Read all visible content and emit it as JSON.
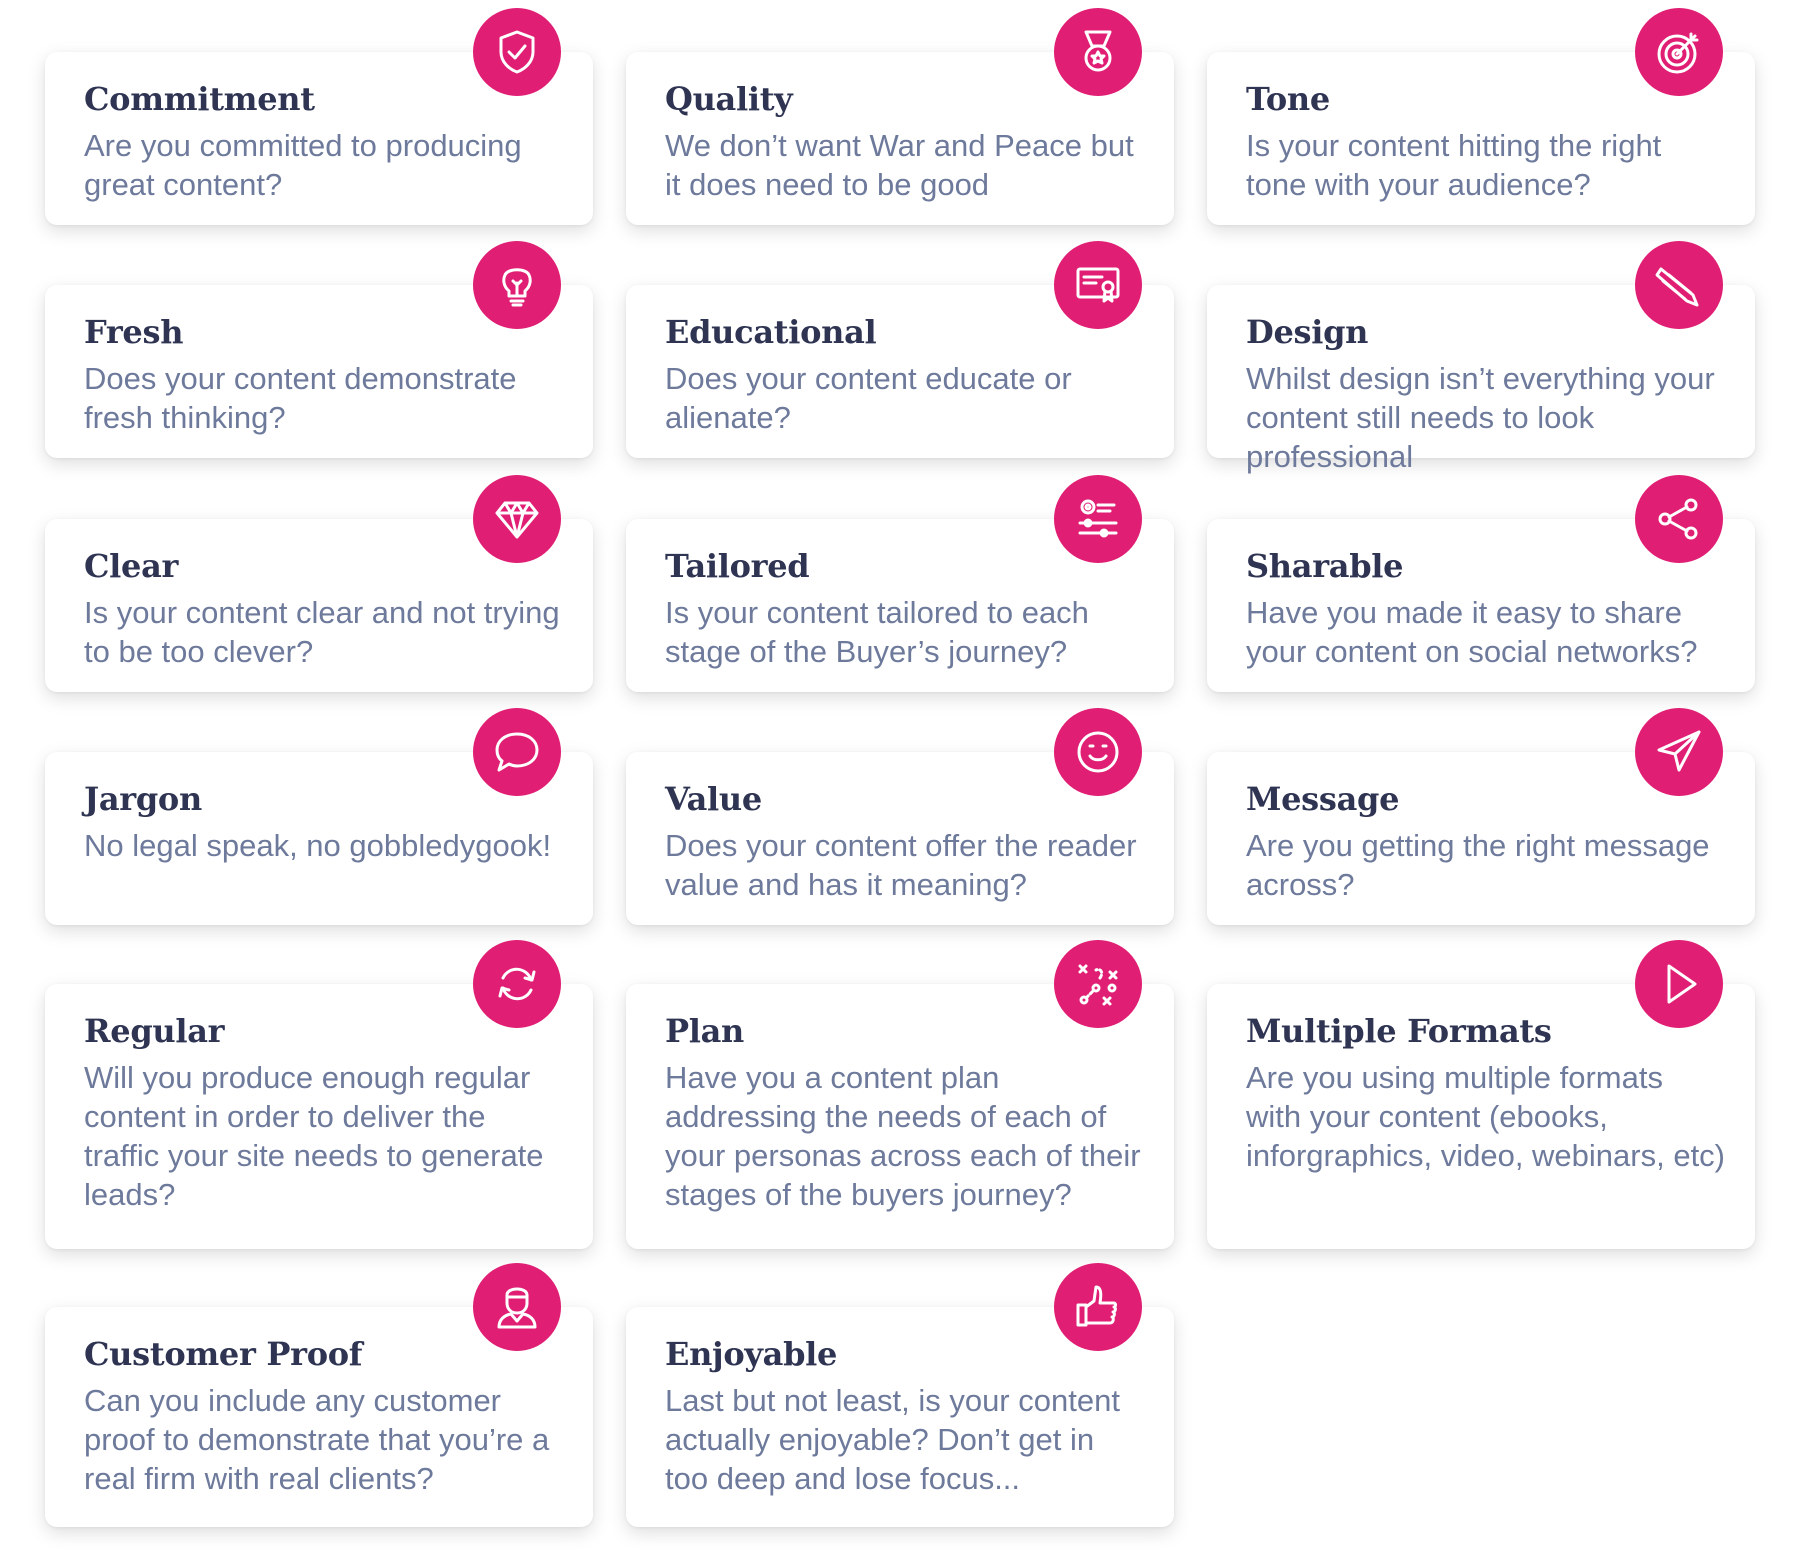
{
  "accent_color": "#e01e73",
  "title_color": "#2e3452",
  "text_color": "#6e7a9b",
  "cards": [
    {
      "title": "Commitment",
      "desc": "Are you committed to producing great content?",
      "icon": "shield-check-icon"
    },
    {
      "title": "Quality",
      "desc": "We don’t want War and Peace but it does need to be good",
      "icon": "medal-icon"
    },
    {
      "title": "Tone",
      "desc": "Is your content hitting the right tone with your audience?",
      "icon": "target-icon"
    },
    {
      "title": "Fresh",
      "desc": "Does your content demonstrate fresh thinking?",
      "icon": "lightbulb-icon"
    },
    {
      "title": "Educational",
      "desc": "Does your content educate or alienate?",
      "icon": "certificate-icon"
    },
    {
      "title": "Design",
      "desc": "Whilst design isn’t everything your content still needs to look professional",
      "icon": "pencil-icon"
    },
    {
      "title": "Clear",
      "desc": "Is your content clear and not trying to be too clever?",
      "icon": "diamond-icon"
    },
    {
      "title": "Tailored",
      "desc": "Is your content tailored to each stage of the Buyer’s journey?",
      "icon": "gear-process-icon"
    },
    {
      "title": "Sharable",
      "desc": "Have you made it easy to share your content on social networks?",
      "icon": "share-icon"
    },
    {
      "title": "Jargon",
      "desc": "No legal speak, no gobbledygook!",
      "icon": "speech-bubble-icon"
    },
    {
      "title": "Value",
      "desc": "Does your content offer the reader value and has it meaning?",
      "icon": "smiley-icon"
    },
    {
      "title": "Message",
      "desc": "Are you getting the right message across?",
      "icon": "paper-plane-icon"
    },
    {
      "title": "Regular",
      "desc": "Will you produce enough regular content in order to deliver the traffic your site needs to generate leads?",
      "icon": "refresh-icon"
    },
    {
      "title": "Plan",
      "desc": "Have you a content plan addressing the needs of each of your personas across each of their stages of the buyers journey?",
      "icon": "strategy-icon"
    },
    {
      "title": "Multiple Formats",
      "desc": "Are you using multiple formats with your content (ebooks, inforgraphics, video, webinars, etc)",
      "icon": "play-icon"
    },
    {
      "title": "Customer Proof",
      "desc": "Can you include any customer proof to demonstrate that you’re a real firm with real clients?",
      "icon": "customer-icon"
    },
    {
      "title": "Enjoyable",
      "desc": "Last but not least, is your content actually enjoyable? Don’t get in too deep and lose focus...",
      "icon": "thumbs-up-icon"
    }
  ]
}
